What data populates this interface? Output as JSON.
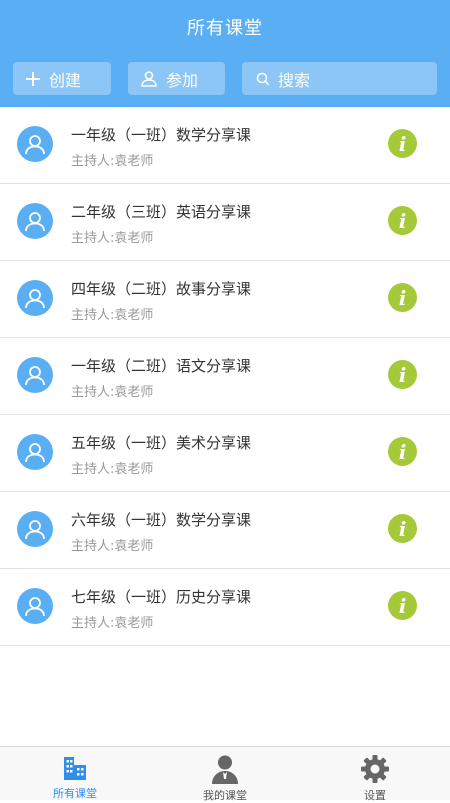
{
  "header": {
    "title": "所有课堂",
    "actions": {
      "create_label": "创建",
      "join_label": "参加",
      "search_label": "搜索"
    }
  },
  "courses": [
    {
      "title": "一年级（一班）数学分享课",
      "host": "主持人:袁老师"
    },
    {
      "title": "二年级（三班）英语分享课",
      "host": "主持人:袁老师"
    },
    {
      "title": "四年级（二班）故事分享课",
      "host": "主持人:袁老师"
    },
    {
      "title": "一年级（二班）语文分享课",
      "host": "主持人:袁老师"
    },
    {
      "title": "五年级（一班）美术分享课",
      "host": "主持人:袁老师"
    },
    {
      "title": "六年级（一班）数学分享课",
      "host": "主持人:袁老师"
    },
    {
      "title": "七年级（一班）历史分享课",
      "host": "主持人:袁老师"
    }
  ],
  "tabbar": {
    "tabs": [
      {
        "label": "所有课堂",
        "icon": "building-icon",
        "active": true
      },
      {
        "label": "我的课堂",
        "icon": "person-icon",
        "active": false
      },
      {
        "label": "设置",
        "icon": "gear-icon",
        "active": false
      }
    ]
  },
  "colors": {
    "accent": "#5aaef3",
    "info": "#a6c93a",
    "tab_active": "#2f8ee8"
  }
}
